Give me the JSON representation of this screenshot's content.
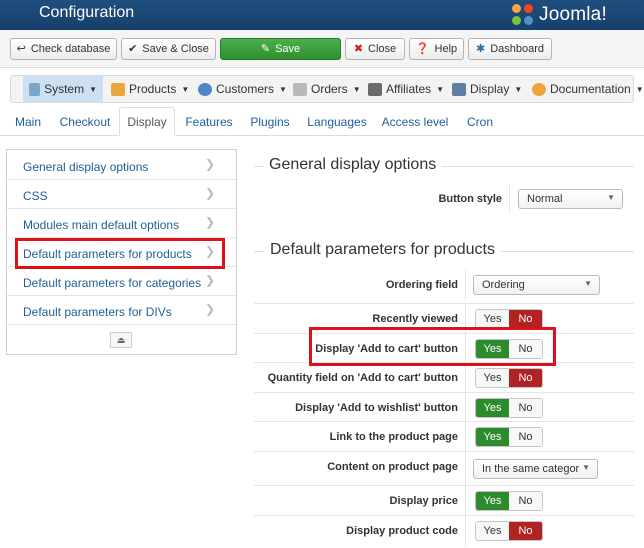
{
  "header": {
    "title": "Configuration",
    "logo_text": "Joomla!"
  },
  "toolbar": {
    "check_database": "Check database",
    "save_close": "Save & Close",
    "save": "Save",
    "close": "Close",
    "help": "Help",
    "dashboard": "Dashboard"
  },
  "menu": {
    "items": [
      {
        "label": "System",
        "icon": "wrench-icon"
      },
      {
        "label": "Products",
        "icon": "box-icon"
      },
      {
        "label": "Customers",
        "icon": "users-icon"
      },
      {
        "label": "Orders",
        "icon": "orders-icon"
      },
      {
        "label": "Affiliates",
        "icon": "affiliates-icon"
      },
      {
        "label": "Display",
        "icon": "display-icon"
      },
      {
        "label": "Documentation",
        "icon": "documentation-icon"
      }
    ]
  },
  "tabs": [
    "Main",
    "Checkout",
    "Display",
    "Features",
    "Plugins",
    "Languages",
    "Access level",
    "Cron"
  ],
  "sidebar": {
    "items": [
      "General display options",
      "CSS",
      "Modules main default options",
      "Default parameters for products",
      "Default parameters for categories",
      "Default parameters for DIVs"
    ]
  },
  "general": {
    "legend": "General display options",
    "button_style_label": "Button style",
    "button_style_value": "Normal"
  },
  "products": {
    "legend": "Default parameters for products",
    "ordering_field_label": "Ordering field",
    "ordering_field_value": "Ordering",
    "recently_viewed_label": "Recently viewed",
    "add_to_cart_label": "Display 'Add to cart' button",
    "quantity_field_label": "Quantity field on 'Add to cart' button",
    "wishlist_label": "Display 'Add to wishlist' button",
    "link_product_label": "Link to the product page",
    "content_label": "Content on product page",
    "content_value": "In the same categor",
    "display_price_label": "Display price",
    "product_code_label": "Display product code"
  },
  "yes": "Yes",
  "no": "No",
  "colors": {
    "header": "#1f4f7f",
    "yes_active": "#2d8a2d",
    "no_active": "#b12222",
    "highlight": "#e0101a",
    "link": "#1f5f99"
  }
}
